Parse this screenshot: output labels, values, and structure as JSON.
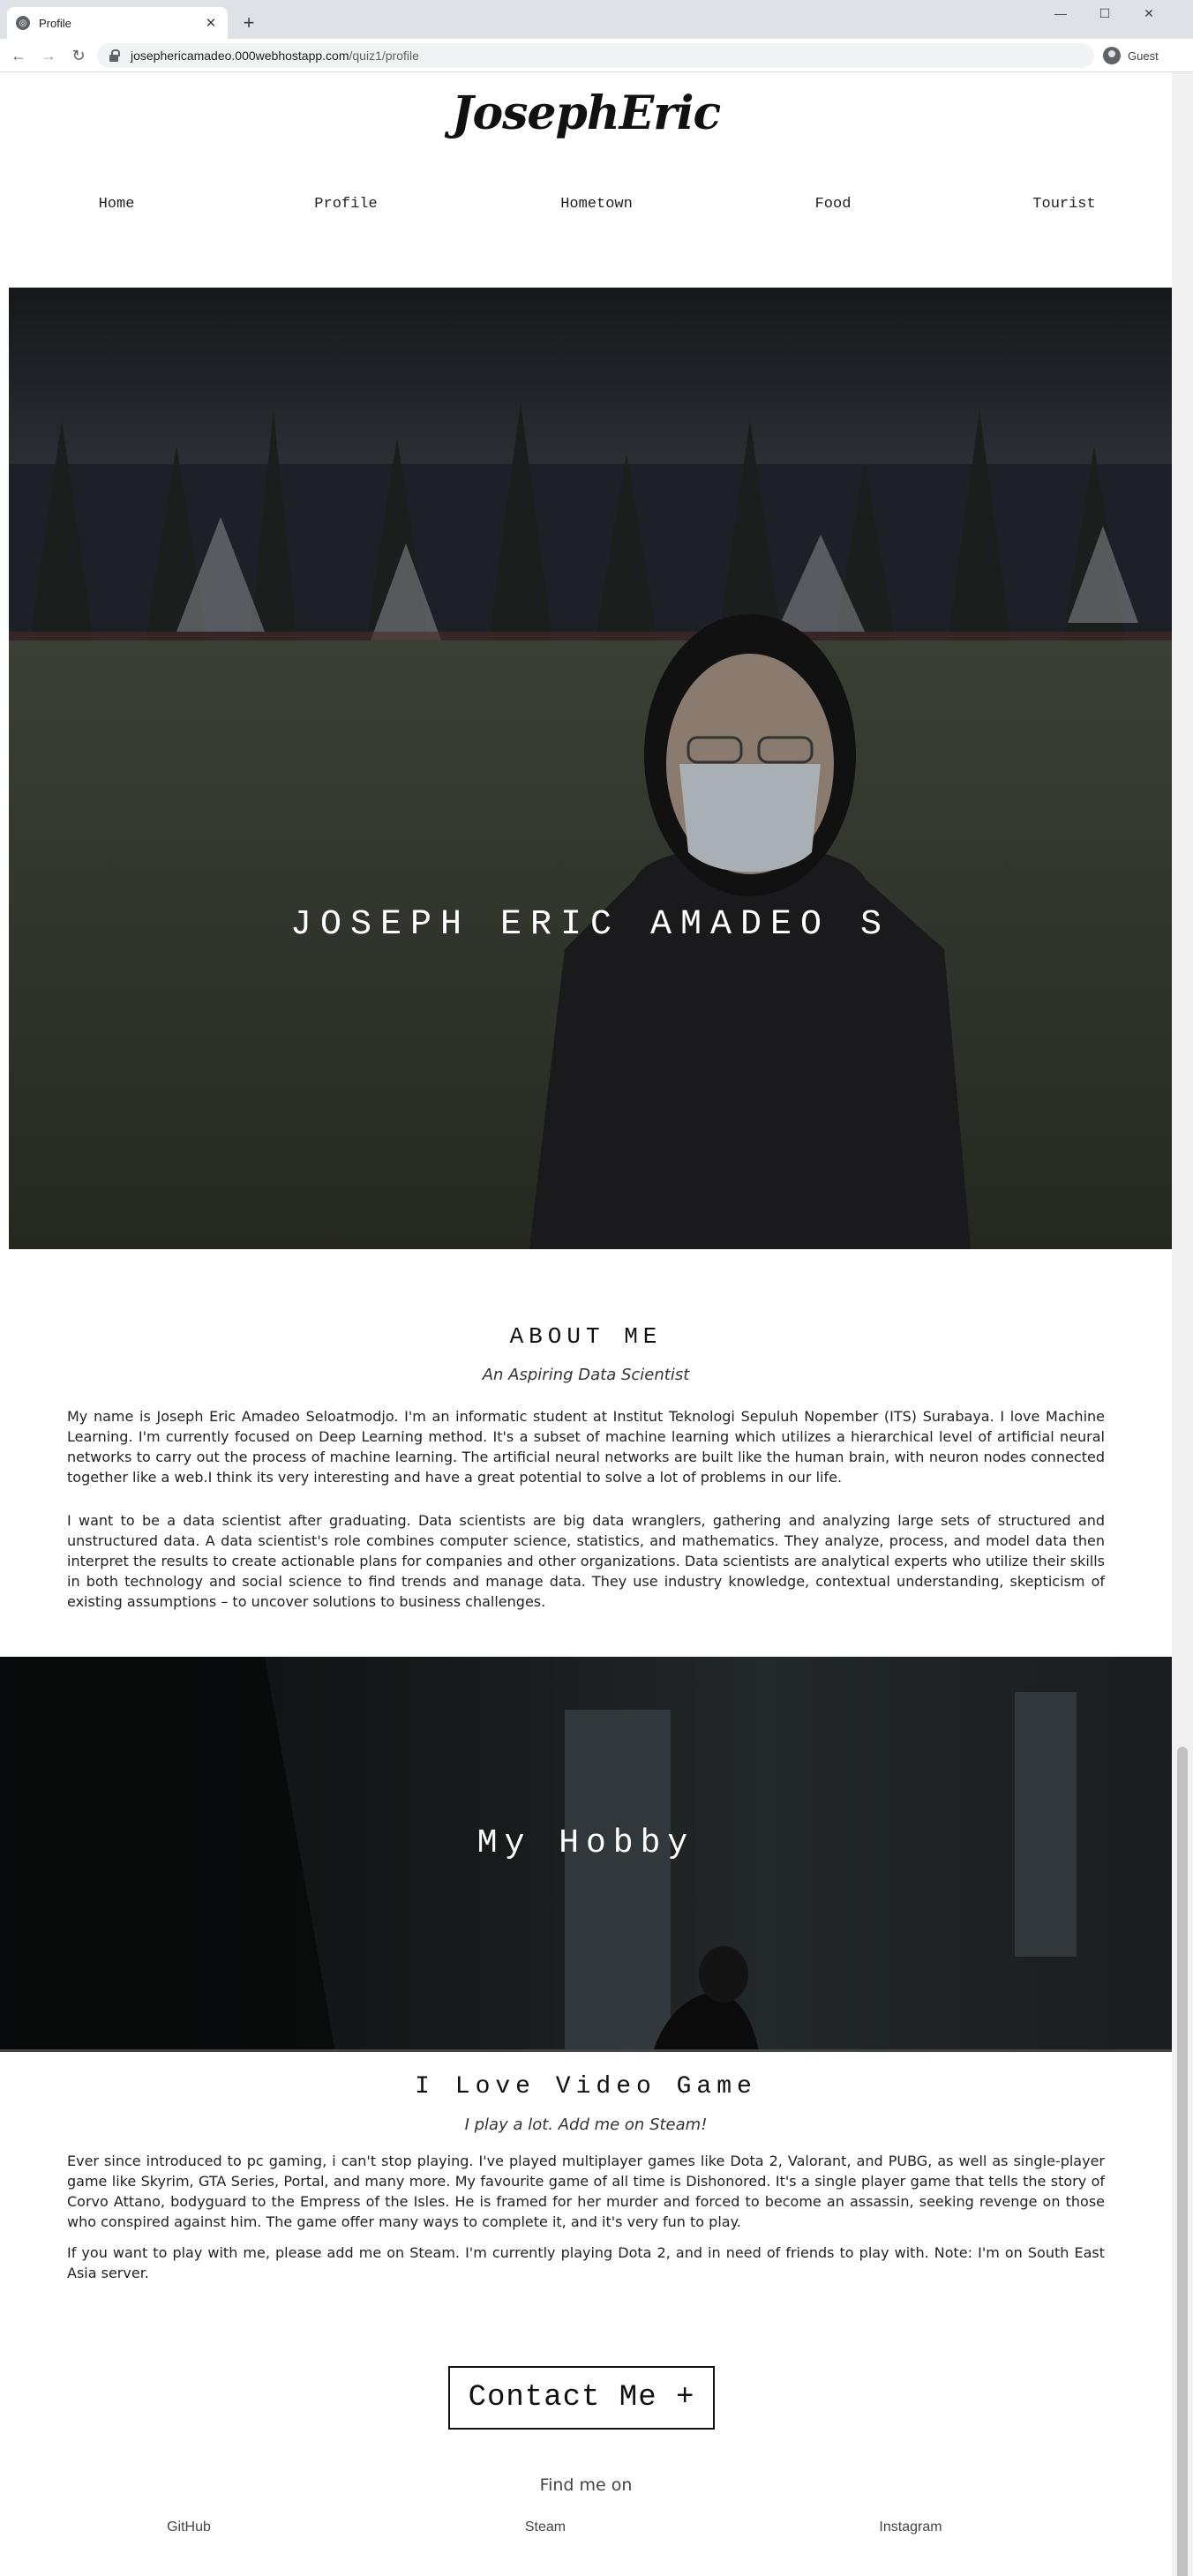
{
  "browser": {
    "tab_title": "Profile",
    "url_host": "josephericamadeo.000webhostapp.com",
    "url_path": "/quiz1/profile",
    "profile_label": "Guest"
  },
  "site": {
    "logo": "JosephEric",
    "nav": [
      {
        "label": "Home"
      },
      {
        "label": "Profile"
      },
      {
        "label": "Hometown"
      },
      {
        "label": "Food"
      },
      {
        "label": "Tourist"
      }
    ]
  },
  "hero": {
    "title": "JOSEPH ERIC AMADEO S"
  },
  "about": {
    "title": "ABOUT ME",
    "subtitle": "An Aspiring Data Scientist",
    "paragraphs": [
      "My name is Joseph Eric Amadeo Seloatmodjo. I'm an informatic student at Institut Teknologi Sepuluh Nopember (ITS) Surabaya. I love Machine Learning. I'm currently focused on Deep Learning method. It's a subset of machine learning which utilizes a hierarchical level of artificial neural networks to carry out the process of machine learning. The artificial neural networks are built like the human brain, with neuron nodes connected together like a web.I think its very interesting and have a great potential to solve a lot of problems in our life.",
      "I want to be a data scientist after graduating. Data scientists are big data wranglers, gathering and analyzing large sets of structured and unstructured data. A data scientist's role combines computer science, statistics, and mathematics. They analyze, process, and model data then interpret the results to create actionable plans for companies and other organizations. Data scientists are analytical experts who utilize their skills in both technology and social science to find trends and manage data. They use industry knowledge, contextual understanding, skepticism of existing assumptions – to uncover solutions to business challenges."
    ]
  },
  "hobby": {
    "banner_title": "My Hobby"
  },
  "game": {
    "title": "I Love Video Game",
    "subtitle": "I play a lot. Add me on Steam!",
    "paragraphs": [
      "Ever since introduced to pc gaming, i can't stop playing. I've played multiplayer games like Dota 2, Valorant, and PUBG, as well as single-player game like Skyrim, GTA Series, Portal, and many more. My favourite game of all time is Dishonored. It's a single player game that tells the story of Corvo Attano, bodyguard to the Empress of the Isles. He is framed for her murder and forced to become an assassin, seeking revenge on those who conspired against him. The game offer many ways to complete it, and it's very fun to play.",
      "If you want to play with me, please add me on Steam. I'm currently playing Dota 2, and in need of friends to play with. Note: I'm on South East Asia server."
    ]
  },
  "contact": {
    "button_label": "Contact Me +"
  },
  "find_me": {
    "label": "Find me on",
    "links": [
      {
        "label": "GitHub"
      },
      {
        "label": "Steam"
      },
      {
        "label": "Instagram"
      }
    ]
  }
}
